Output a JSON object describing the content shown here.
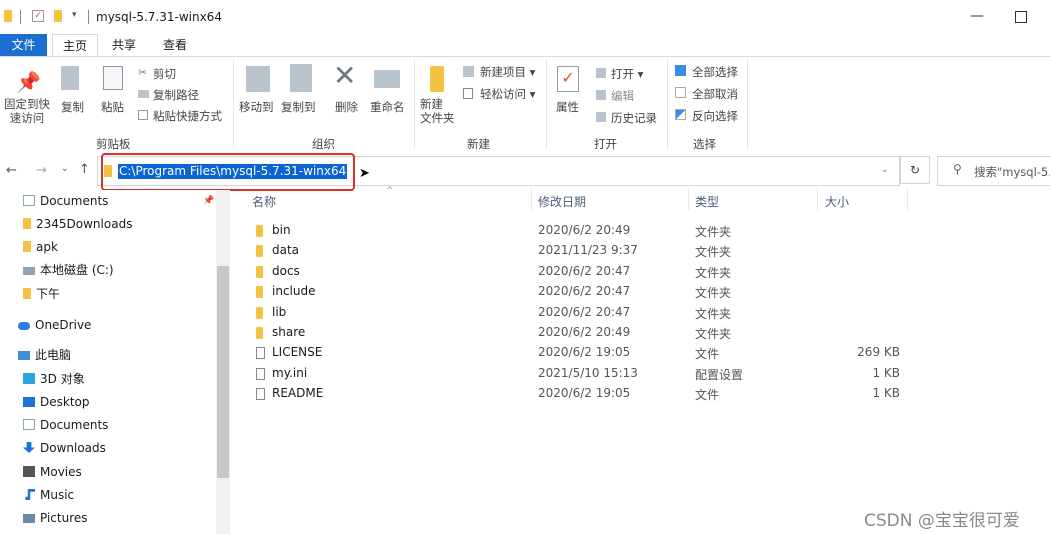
{
  "window": {
    "title": "mysql-5.7.31-winx64",
    "minimize": "—"
  },
  "tabs": [
    "文件",
    "主页",
    "共享",
    "查看"
  ],
  "ribbon": {
    "clipboard": {
      "pin": "固定到快\n速访问",
      "copy": "复制",
      "paste": "粘贴",
      "cut": "剪切",
      "copy_path": "复制路径",
      "paste_shortcut": "粘贴快捷方式",
      "group": "剪贴板"
    },
    "organize": {
      "move_to": "移动到",
      "copy_to": "复制到",
      "delete": "删除",
      "rename": "重命名",
      "group": "组织"
    },
    "new": {
      "new_folder": "新建\n文件夹",
      "new_item": "新建项目 ▾",
      "easy_access": "轻松访问 ▾",
      "group": "新建"
    },
    "open": {
      "properties": "属性",
      "open": "打开 ▾",
      "edit": "编辑",
      "history": "历史记录",
      "group": "打开"
    },
    "select": {
      "select_all": "全部选择",
      "select_none": "全部取消",
      "invert": "反向选择",
      "group": "选择"
    }
  },
  "address": {
    "path": "C:\\Program Files\\mysql-5.7.31-winx64",
    "search_placeholder": "搜索\"mysql-5."
  },
  "nav": [
    {
      "label": "Documents",
      "icon": "document-icon"
    },
    {
      "label": "2345Downloads",
      "icon": "folder-icon"
    },
    {
      "label": "apk",
      "icon": "folder-icon"
    },
    {
      "label": "本地磁盘 (C:)",
      "icon": "drive-icon"
    },
    {
      "label": "下午",
      "icon": "folder-icon"
    },
    {
      "label": "OneDrive",
      "icon": "cloud-icon"
    },
    {
      "label": "此电脑",
      "icon": "computer-icon"
    },
    {
      "label": "3D 对象",
      "icon": "cube-icon"
    },
    {
      "label": "Desktop",
      "icon": "desktop-icon"
    },
    {
      "label": "Documents",
      "icon": "document-icon"
    },
    {
      "label": "Downloads",
      "icon": "download-icon"
    },
    {
      "label": "Movies",
      "icon": "video-icon"
    },
    {
      "label": "Music",
      "icon": "music-icon"
    },
    {
      "label": "Pictures",
      "icon": "picture-icon"
    }
  ],
  "columns": {
    "name": "名称",
    "modified": "修改日期",
    "type": "类型",
    "size": "大小"
  },
  "files": [
    {
      "name": "bin",
      "date": "2020/6/2 20:49",
      "type": "文件夹",
      "size": "",
      "kind": "folder"
    },
    {
      "name": "data",
      "date": "2021/11/23 9:37",
      "type": "文件夹",
      "size": "",
      "kind": "folder"
    },
    {
      "name": "docs",
      "date": "2020/6/2 20:47",
      "type": "文件夹",
      "size": "",
      "kind": "folder"
    },
    {
      "name": "include",
      "date": "2020/6/2 20:47",
      "type": "文件夹",
      "size": "",
      "kind": "folder"
    },
    {
      "name": "lib",
      "date": "2020/6/2 20:47",
      "type": "文件夹",
      "size": "",
      "kind": "folder"
    },
    {
      "name": "share",
      "date": "2020/6/2 20:49",
      "type": "文件夹",
      "size": "",
      "kind": "folder"
    },
    {
      "name": "LICENSE",
      "date": "2020/6/2 19:05",
      "type": "文件",
      "size": "269 KB",
      "kind": "file"
    },
    {
      "name": "my.ini",
      "date": "2021/5/10 15:13",
      "type": "配置设置",
      "size": "1 KB",
      "kind": "ini"
    },
    {
      "name": "README",
      "date": "2020/6/2 19:05",
      "type": "文件",
      "size": "1 KB",
      "kind": "file"
    }
  ],
  "watermark": "CSDN @宝宝很可爱"
}
